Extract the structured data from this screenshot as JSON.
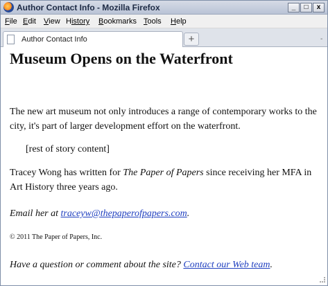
{
  "window": {
    "title": "Author Contact Info - Mozilla Firefox",
    "min_label": "_",
    "max_label": "□",
    "close_label": "x"
  },
  "menubar": {
    "items": [
      {
        "label": "File",
        "key": "F",
        "rest": "ile"
      },
      {
        "label": "Edit",
        "key": "E",
        "rest": "dit"
      },
      {
        "label": "View",
        "key": "V",
        "rest": "iew"
      },
      {
        "label": "History",
        "key": "H",
        "rest": "istory"
      },
      {
        "label": "Bookmarks",
        "key": "B",
        "rest": "ookmarks"
      },
      {
        "label": "Tools",
        "key": "T",
        "rest": "ools"
      },
      {
        "label": "Help",
        "key": "H",
        "rest": "elp"
      }
    ]
  },
  "tabs": {
    "active_label": "Author Contact Info",
    "newtab_label": "+",
    "scroll_label": "-"
  },
  "page": {
    "headline": "Museum Opens on the Waterfront",
    "intro": "The new art museum not only introduces a range of contemporary works to the city, it's part of larger development effort on the waterfront.",
    "placeholder": "[rest of story content]",
    "bio_before": "Tracey Wong has written for ",
    "bio_pub": "The Paper of Papers",
    "bio_after": " since receiving her MFA in Art History three years ago.",
    "email_prefix": "Email her at ",
    "email_link": "traceyw@thepaperofpapers.com",
    "email_suffix": ".",
    "copyright": "© 2011 The Paper of Papers, Inc.",
    "question": "Have a question or comment about the site? ",
    "contact_link": "Contact our Web team",
    "contact_suffix": "."
  }
}
